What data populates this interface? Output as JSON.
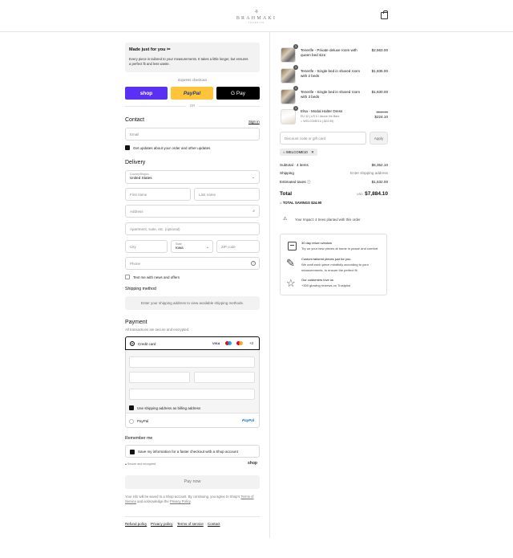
{
  "header": {
    "logo_text": "BRAHMAKI",
    "logo_sub": "TENERIFE"
  },
  "made_for_you": {
    "title": "Made just for you",
    "description": "Every piece is tailored to your measurements. It takes a little longer, but ensures a perfect fit and less waste."
  },
  "express": {
    "label": "Express checkout",
    "shop": "shop",
    "paypal": "PayPal",
    "gpay": "G Pay",
    "or": "OR"
  },
  "contact": {
    "title": "Contact",
    "sign_in": "Sign in",
    "email_placeholder": "Email",
    "updates_label": "Get updates about your order and other updates"
  },
  "delivery": {
    "title": "Delivery",
    "country_label": "Country/Region",
    "country_value": "United States",
    "first_name": "First name",
    "last_name": "Last name",
    "address": "Address",
    "apartment": "Apartment, suite, etc. (optional)",
    "city": "City",
    "state_label": "State",
    "state_value": "Iowa",
    "zip": "ZIP code",
    "phone": "Phone",
    "news_label": "Text me with news and offers"
  },
  "shipping": {
    "title": "Shipping method",
    "note": "Enter your shipping address to view available shipping methods."
  },
  "payment": {
    "title": "Payment",
    "subtitle": "All transactions are secure and encrypted.",
    "credit_card": "Credit card",
    "more_cards": "+3",
    "billing_label": "Use shipping address as billing address",
    "paypal": "PayPal"
  },
  "remember": {
    "title": "Remember me",
    "save_label": "Save my information for a faster checkout with a Shop account",
    "secure": "Secure and encrypted",
    "shop_logo": "shop"
  },
  "pay_now": "Pay now",
  "legal": {
    "text": "Your info will be saved to a Shop account. By continuing, you agree to Shop's",
    "terms": "Terms of Service",
    "and": "and acknowledge the",
    "privacy": "Privacy Policy",
    "end": "."
  },
  "footer_links": [
    "Refund policy",
    "Privacy policy",
    "Terms of service",
    "Contact"
  ],
  "order": {
    "items": [
      {
        "qty": "1",
        "name": "Tenerife - Private deluxe room with queen bed size",
        "price": "$2,563.00"
      },
      {
        "qty": "1",
        "name": "Tenerife - Single bed in shared room with 2 beds",
        "price": "$1,835.00"
      },
      {
        "qty": "1",
        "name": "Tenerife - Single bed in shared room with 3 beds",
        "price": "$1,630.00"
      },
      {
        "qty": "1",
        "name": "Elsa - Modal Halter Dress",
        "variant": "EU 32 | US 0 / Above the Bare",
        "discount": "WELCOME10 (-$24.90)",
        "old_price": "$249.00",
        "price": "$224.10"
      }
    ],
    "discount_placeholder": "Discount code or gift card",
    "apply": "Apply",
    "applied_code": "WELCOME10",
    "subtotal_label": "Subtotal · 4 items",
    "subtotal": "$6,352.10",
    "shipping_label": "Shipping",
    "shipping_value": "Enter shipping address",
    "taxes_label": "Estimated taxes",
    "taxes_value": "$1,532.00",
    "total_label": "Total",
    "currency": "USD",
    "total": "$7,884.10",
    "savings_label": "TOTAL SAVINGS",
    "savings": "$24.90",
    "impact": "Your Impact: 4 trees planted with this order"
  },
  "info": [
    {
      "icon": "calendar-icon",
      "title": "30 day return window",
      "text": "Try on your new pieces at home in peace and comfort"
    },
    {
      "icon": "pencil-icon",
      "title": "Custom tailored pieces just for you.",
      "text": "We craft each piece mindfully according to your measurements, to ensure the perfect fit"
    },
    {
      "icon": "star-icon",
      "title": "Our customers love us",
      "text": "+300 glowing reviews on Trustpilot"
    }
  ]
}
